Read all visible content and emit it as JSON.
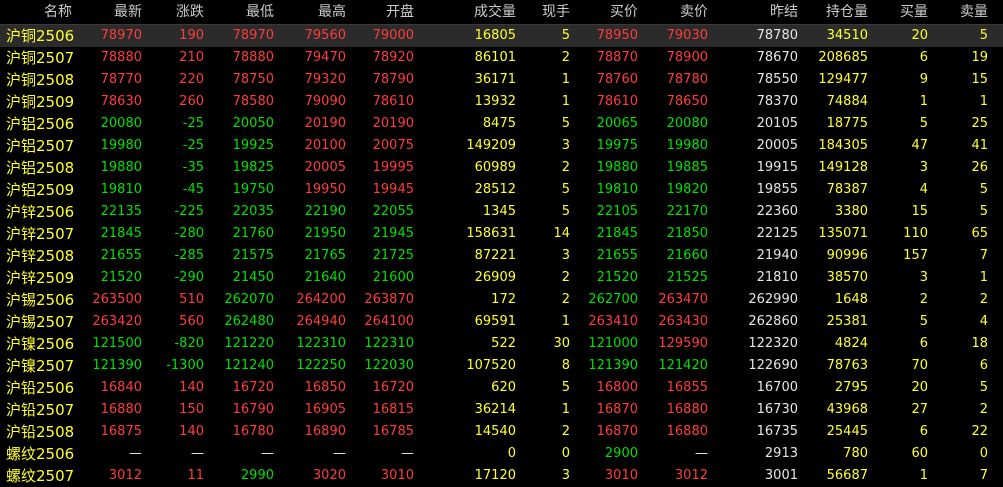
{
  "columns": {
    "name": "名称",
    "last": "最新",
    "change": "涨跌",
    "low": "最低",
    "high": "最高",
    "open": "开盘",
    "volume": "成交量",
    "cur_vol": "现手",
    "bid": "买价",
    "ask": "卖价",
    "prev_settle": "昨结",
    "open_interest": "持仓量",
    "bid_vol": "买量",
    "ask_vol": "卖量"
  },
  "colors": {
    "up": "#ff3c3c",
    "down": "#00e000",
    "neutral": "#e6e6e6",
    "yellow": "#ffff2e",
    "header": "#cbcbcb"
  },
  "rows": [
    {
      "name": "沪铜2506",
      "last": "78970",
      "change": "190",
      "low": "78970",
      "high": "79560",
      "open": "79000",
      "volume": "16805",
      "cur_vol": "5",
      "bid": "78950",
      "ask": "79030",
      "prev_settle": "78780",
      "open_interest": "34510",
      "bid_vol": "20",
      "ask_vol": "5"
    },
    {
      "name": "沪铜2507",
      "last": "78880",
      "change": "210",
      "low": "78880",
      "high": "79470",
      "open": "78920",
      "volume": "86101",
      "cur_vol": "2",
      "bid": "78870",
      "ask": "78900",
      "prev_settle": "78670",
      "open_interest": "208685",
      "bid_vol": "6",
      "ask_vol": "19"
    },
    {
      "name": "沪铜2508",
      "last": "78770",
      "change": "220",
      "low": "78750",
      "high": "79320",
      "open": "78790",
      "volume": "36171",
      "cur_vol": "1",
      "bid": "78760",
      "ask": "78780",
      "prev_settle": "78550",
      "open_interest": "129477",
      "bid_vol": "9",
      "ask_vol": "15"
    },
    {
      "name": "沪铜2509",
      "last": "78630",
      "change": "260",
      "low": "78580",
      "high": "79090",
      "open": "78610",
      "volume": "13932",
      "cur_vol": "1",
      "bid": "78610",
      "ask": "78650",
      "prev_settle": "78370",
      "open_interest": "74884",
      "bid_vol": "1",
      "ask_vol": "1"
    },
    {
      "name": "沪铝2506",
      "last": "20080",
      "change": "-25",
      "low": "20050",
      "high": "20190",
      "open": "20190",
      "volume": "8475",
      "cur_vol": "5",
      "bid": "20065",
      "ask": "20080",
      "prev_settle": "20105",
      "open_interest": "18775",
      "bid_vol": "5",
      "ask_vol": "25"
    },
    {
      "name": "沪铝2507",
      "last": "19980",
      "change": "-25",
      "low": "19925",
      "high": "20100",
      "open": "20075",
      "volume": "149209",
      "cur_vol": "3",
      "bid": "19975",
      "ask": "19980",
      "prev_settle": "20005",
      "open_interest": "184305",
      "bid_vol": "47",
      "ask_vol": "41"
    },
    {
      "name": "沪铝2508",
      "last": "19880",
      "change": "-35",
      "low": "19825",
      "high": "20005",
      "open": "19995",
      "volume": "60989",
      "cur_vol": "2",
      "bid": "19880",
      "ask": "19885",
      "prev_settle": "19915",
      "open_interest": "149128",
      "bid_vol": "3",
      "ask_vol": "26"
    },
    {
      "name": "沪铝2509",
      "last": "19810",
      "change": "-45",
      "low": "19750",
      "high": "19950",
      "open": "19945",
      "volume": "28512",
      "cur_vol": "5",
      "bid": "19810",
      "ask": "19820",
      "prev_settle": "19855",
      "open_interest": "78387",
      "bid_vol": "4",
      "ask_vol": "5"
    },
    {
      "name": "沪锌2506",
      "last": "22135",
      "change": "-225",
      "low": "22035",
      "high": "22190",
      "open": "22055",
      "volume": "1345",
      "cur_vol": "5",
      "bid": "22105",
      "ask": "22170",
      "prev_settle": "22360",
      "open_interest": "3380",
      "bid_vol": "15",
      "ask_vol": "5"
    },
    {
      "name": "沪锌2507",
      "last": "21845",
      "change": "-280",
      "low": "21760",
      "high": "21950",
      "open": "21945",
      "volume": "158631",
      "cur_vol": "14",
      "bid": "21845",
      "ask": "21850",
      "prev_settle": "22125",
      "open_interest": "135071",
      "bid_vol": "110",
      "ask_vol": "65"
    },
    {
      "name": "沪锌2508",
      "last": "21655",
      "change": "-285",
      "low": "21575",
      "high": "21765",
      "open": "21725",
      "volume": "87221",
      "cur_vol": "3",
      "bid": "21655",
      "ask": "21660",
      "prev_settle": "21940",
      "open_interest": "90996",
      "bid_vol": "157",
      "ask_vol": "7"
    },
    {
      "name": "沪锌2509",
      "last": "21520",
      "change": "-290",
      "low": "21450",
      "high": "21640",
      "open": "21600",
      "volume": "26909",
      "cur_vol": "2",
      "bid": "21520",
      "ask": "21525",
      "prev_settle": "21810",
      "open_interest": "38570",
      "bid_vol": "3",
      "ask_vol": "1"
    },
    {
      "name": "沪锡2506",
      "last": "263500",
      "change": "510",
      "low": "262070",
      "high": "264200",
      "open": "263870",
      "volume": "172",
      "cur_vol": "2",
      "bid": "262700",
      "ask": "263470",
      "prev_settle": "262990",
      "open_interest": "1648",
      "bid_vol": "2",
      "ask_vol": "2"
    },
    {
      "name": "沪锡2507",
      "last": "263420",
      "change": "560",
      "low": "262480",
      "high": "264940",
      "open": "264100",
      "volume": "69591",
      "cur_vol": "1",
      "bid": "263410",
      "ask": "263430",
      "prev_settle": "262860",
      "open_interest": "25381",
      "bid_vol": "5",
      "ask_vol": "4"
    },
    {
      "name": "沪镍2506",
      "last": "121500",
      "change": "-820",
      "low": "121220",
      "high": "122310",
      "open": "122310",
      "volume": "522",
      "cur_vol": "30",
      "bid": "121000",
      "ask": "129590",
      "prev_settle": "122320",
      "open_interest": "4824",
      "bid_vol": "6",
      "ask_vol": "18"
    },
    {
      "name": "沪镍2507",
      "last": "121390",
      "change": "-1300",
      "low": "121240",
      "high": "122250",
      "open": "122030",
      "volume": "107520",
      "cur_vol": "8",
      "bid": "121390",
      "ask": "121420",
      "prev_settle": "122690",
      "open_interest": "78763",
      "bid_vol": "70",
      "ask_vol": "6"
    },
    {
      "name": "沪铅2506",
      "last": "16840",
      "change": "140",
      "low": "16720",
      "high": "16850",
      "open": "16720",
      "volume": "620",
      "cur_vol": "5",
      "bid": "16800",
      "ask": "16855",
      "prev_settle": "16700",
      "open_interest": "2795",
      "bid_vol": "20",
      "ask_vol": "5"
    },
    {
      "name": "沪铅2507",
      "last": "16880",
      "change": "150",
      "low": "16790",
      "high": "16905",
      "open": "16815",
      "volume": "36214",
      "cur_vol": "1",
      "bid": "16870",
      "ask": "16880",
      "prev_settle": "16730",
      "open_interest": "43968",
      "bid_vol": "27",
      "ask_vol": "2"
    },
    {
      "name": "沪铅2508",
      "last": "16875",
      "change": "140",
      "low": "16780",
      "high": "16890",
      "open": "16785",
      "volume": "14540",
      "cur_vol": "2",
      "bid": "16870",
      "ask": "16880",
      "prev_settle": "16735",
      "open_interest": "25445",
      "bid_vol": "6",
      "ask_vol": "22"
    },
    {
      "name": "螺纹2506",
      "last": "—",
      "change": "—",
      "low": "—",
      "high": "—",
      "open": "—",
      "volume": "0",
      "cur_vol": "0",
      "bid": "2900",
      "ask": "—",
      "prev_settle": "2913",
      "open_interest": "780",
      "bid_vol": "60",
      "ask_vol": "0"
    },
    {
      "name": "螺纹2507",
      "last": "3012",
      "change": "11",
      "low": "2990",
      "high": "3020",
      "open": "3010",
      "volume": "17120",
      "cur_vol": "3",
      "bid": "3010",
      "ask": "3012",
      "prev_settle": "3001",
      "open_interest": "56687",
      "bid_vol": "1",
      "ask_vol": "7"
    }
  ]
}
